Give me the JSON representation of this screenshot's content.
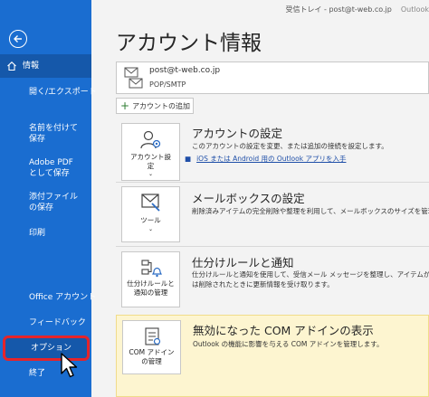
{
  "window": {
    "mailbox": "受信トレイ - post@t-web.co.jp",
    "app": "Outlook"
  },
  "sidebar": {
    "items": [
      {
        "label": "情報"
      },
      {
        "label": "開く/エクスポート"
      },
      {
        "label": "名前を付けて保存"
      },
      {
        "label": "Adobe PDF として保存"
      },
      {
        "label": "添付ファイルの保存"
      },
      {
        "label": "印刷"
      },
      {
        "label": "Office アカウント"
      },
      {
        "label": "フィードバック"
      },
      {
        "label": "オプション"
      },
      {
        "label": "終了"
      }
    ],
    "accent": "#1a6dd0",
    "highlight": "#e5242a"
  },
  "main": {
    "title": "アカウント情報",
    "account": {
      "email": "post@t-web.co.jp",
      "type": "POP/SMTP"
    },
    "add_account": "アカウントの追加",
    "sections": [
      {
        "tile": "アカウント設定",
        "title": "アカウントの設定",
        "desc": "このアカウントの設定を変更、または追加の接続を設定します。",
        "link": "iOS または Android 用の Outlook アプリを入手"
      },
      {
        "tile": "ツール",
        "title": "メールボックスの設定",
        "desc": "削除済みアイテムの完全削除や整理を利用して、メールボックスのサイズを管理"
      },
      {
        "tile": "仕分けルールと通知の管理",
        "title": "仕分けルールと通知",
        "desc1": "仕分けルールと通知を使用して、受信メール メッセージを整理し、アイテムが追",
        "desc2": "は削除されたときに更新情報を受け取ります。"
      },
      {
        "tile": "COM アドインの管理",
        "title": "無効になった COM アドインの表示",
        "desc": "Outlook の機能に影響を与える COM アドインを管理します。"
      }
    ]
  }
}
